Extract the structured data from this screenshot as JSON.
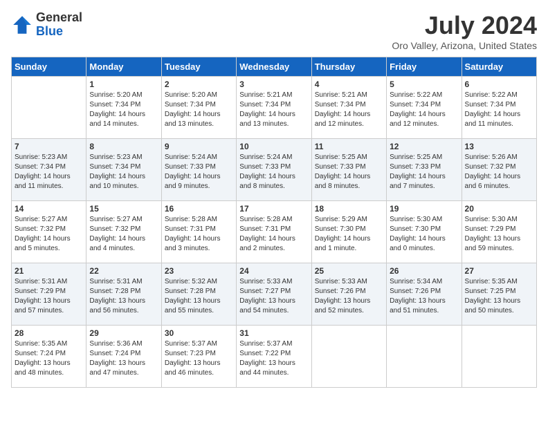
{
  "header": {
    "logo_line1": "General",
    "logo_line2": "Blue",
    "month_title": "July 2024",
    "location": "Oro Valley, Arizona, United States"
  },
  "weekdays": [
    "Sunday",
    "Monday",
    "Tuesday",
    "Wednesday",
    "Thursday",
    "Friday",
    "Saturday"
  ],
  "weeks": [
    [
      {
        "day": "",
        "info": ""
      },
      {
        "day": "1",
        "info": "Sunrise: 5:20 AM\nSunset: 7:34 PM\nDaylight: 14 hours\nand 14 minutes."
      },
      {
        "day": "2",
        "info": "Sunrise: 5:20 AM\nSunset: 7:34 PM\nDaylight: 14 hours\nand 13 minutes."
      },
      {
        "day": "3",
        "info": "Sunrise: 5:21 AM\nSunset: 7:34 PM\nDaylight: 14 hours\nand 13 minutes."
      },
      {
        "day": "4",
        "info": "Sunrise: 5:21 AM\nSunset: 7:34 PM\nDaylight: 14 hours\nand 12 minutes."
      },
      {
        "day": "5",
        "info": "Sunrise: 5:22 AM\nSunset: 7:34 PM\nDaylight: 14 hours\nand 12 minutes."
      },
      {
        "day": "6",
        "info": "Sunrise: 5:22 AM\nSunset: 7:34 PM\nDaylight: 14 hours\nand 11 minutes."
      }
    ],
    [
      {
        "day": "7",
        "info": "Sunrise: 5:23 AM\nSunset: 7:34 PM\nDaylight: 14 hours\nand 11 minutes."
      },
      {
        "day": "8",
        "info": "Sunrise: 5:23 AM\nSunset: 7:34 PM\nDaylight: 14 hours\nand 10 minutes."
      },
      {
        "day": "9",
        "info": "Sunrise: 5:24 AM\nSunset: 7:33 PM\nDaylight: 14 hours\nand 9 minutes."
      },
      {
        "day": "10",
        "info": "Sunrise: 5:24 AM\nSunset: 7:33 PM\nDaylight: 14 hours\nand 8 minutes."
      },
      {
        "day": "11",
        "info": "Sunrise: 5:25 AM\nSunset: 7:33 PM\nDaylight: 14 hours\nand 8 minutes."
      },
      {
        "day": "12",
        "info": "Sunrise: 5:25 AM\nSunset: 7:33 PM\nDaylight: 14 hours\nand 7 minutes."
      },
      {
        "day": "13",
        "info": "Sunrise: 5:26 AM\nSunset: 7:32 PM\nDaylight: 14 hours\nand 6 minutes."
      }
    ],
    [
      {
        "day": "14",
        "info": "Sunrise: 5:27 AM\nSunset: 7:32 PM\nDaylight: 14 hours\nand 5 minutes."
      },
      {
        "day": "15",
        "info": "Sunrise: 5:27 AM\nSunset: 7:32 PM\nDaylight: 14 hours\nand 4 minutes."
      },
      {
        "day": "16",
        "info": "Sunrise: 5:28 AM\nSunset: 7:31 PM\nDaylight: 14 hours\nand 3 minutes."
      },
      {
        "day": "17",
        "info": "Sunrise: 5:28 AM\nSunset: 7:31 PM\nDaylight: 14 hours\nand 2 minutes."
      },
      {
        "day": "18",
        "info": "Sunrise: 5:29 AM\nSunset: 7:30 PM\nDaylight: 14 hours\nand 1 minute."
      },
      {
        "day": "19",
        "info": "Sunrise: 5:30 AM\nSunset: 7:30 PM\nDaylight: 14 hours\nand 0 minutes."
      },
      {
        "day": "20",
        "info": "Sunrise: 5:30 AM\nSunset: 7:29 PM\nDaylight: 13 hours\nand 59 minutes."
      }
    ],
    [
      {
        "day": "21",
        "info": "Sunrise: 5:31 AM\nSunset: 7:29 PM\nDaylight: 13 hours\nand 57 minutes."
      },
      {
        "day": "22",
        "info": "Sunrise: 5:31 AM\nSunset: 7:28 PM\nDaylight: 13 hours\nand 56 minutes."
      },
      {
        "day": "23",
        "info": "Sunrise: 5:32 AM\nSunset: 7:28 PM\nDaylight: 13 hours\nand 55 minutes."
      },
      {
        "day": "24",
        "info": "Sunrise: 5:33 AM\nSunset: 7:27 PM\nDaylight: 13 hours\nand 54 minutes."
      },
      {
        "day": "25",
        "info": "Sunrise: 5:33 AM\nSunset: 7:26 PM\nDaylight: 13 hours\nand 52 minutes."
      },
      {
        "day": "26",
        "info": "Sunrise: 5:34 AM\nSunset: 7:26 PM\nDaylight: 13 hours\nand 51 minutes."
      },
      {
        "day": "27",
        "info": "Sunrise: 5:35 AM\nSunset: 7:25 PM\nDaylight: 13 hours\nand 50 minutes."
      }
    ],
    [
      {
        "day": "28",
        "info": "Sunrise: 5:35 AM\nSunset: 7:24 PM\nDaylight: 13 hours\nand 48 minutes."
      },
      {
        "day": "29",
        "info": "Sunrise: 5:36 AM\nSunset: 7:24 PM\nDaylight: 13 hours\nand 47 minutes."
      },
      {
        "day": "30",
        "info": "Sunrise: 5:37 AM\nSunset: 7:23 PM\nDaylight: 13 hours\nand 46 minutes."
      },
      {
        "day": "31",
        "info": "Sunrise: 5:37 AM\nSunset: 7:22 PM\nDaylight: 13 hours\nand 44 minutes."
      },
      {
        "day": "",
        "info": ""
      },
      {
        "day": "",
        "info": ""
      },
      {
        "day": "",
        "info": ""
      }
    ]
  ]
}
